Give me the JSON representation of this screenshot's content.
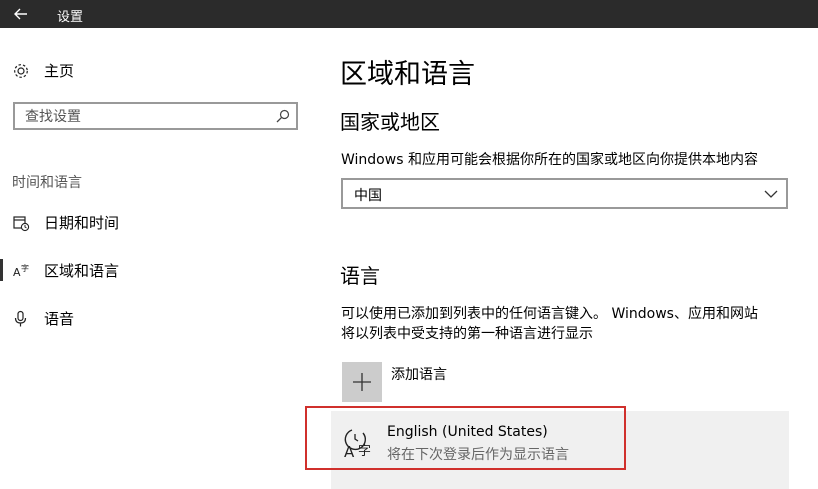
{
  "window": {
    "title": "设置"
  },
  "sidebar": {
    "home_label": "主页",
    "search_placeholder": "查找设置",
    "section_label": "时间和语言",
    "items": [
      {
        "label": "日期和时间",
        "icon": "calendar-clock-icon"
      },
      {
        "label": "区域和语言",
        "icon": "language-icon",
        "selected": true
      },
      {
        "label": "语音",
        "icon": "microphone-icon"
      }
    ]
  },
  "main": {
    "title": "区域和语言",
    "region": {
      "heading": "国家或地区",
      "description": "Windows 和应用可能会根据你所在的国家或地区向你提供本地内容",
      "selected": "中国"
    },
    "language": {
      "heading": "语言",
      "description_line1": "可以使用已添加到列表中的任何语言键入。 Windows、应用和网站",
      "description_line2": "将以列表中受支持的第一种语言进行显示",
      "add_label": "添加语言",
      "entries": [
        {
          "name": "English (United States)",
          "status": "将在下次登录后作为显示语言"
        }
      ]
    }
  },
  "colors": {
    "titlebar": "#2b2b2b",
    "highlight": "#d0302c",
    "add_tile": "#cccccc"
  }
}
